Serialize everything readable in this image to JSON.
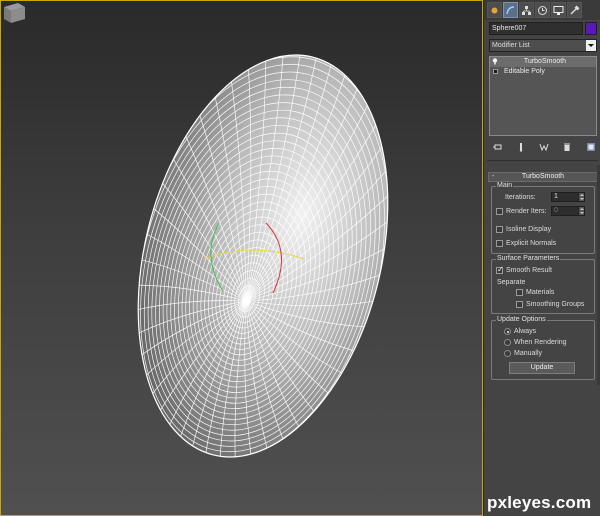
{
  "object": {
    "name": "Sphere007",
    "color": "#5a18b8"
  },
  "modifier_list": {
    "label": "Modifier List"
  },
  "stack": {
    "items": [
      {
        "label": "TurboSmooth",
        "selected": true
      },
      {
        "label": "Editable Poly",
        "selected": false
      }
    ]
  },
  "tabs": [
    "create-tab",
    "modify-tab",
    "hierarchy-tab",
    "motion-tab",
    "display-tab",
    "utilities-tab"
  ],
  "turbosmooth": {
    "title": "TurboSmooth",
    "main": {
      "title": "Main",
      "iterations_label": "Iterations:",
      "iterations_value": "1",
      "render_iters_label": "Render Iters:",
      "render_iters_value": "0",
      "isoline_display_label": "Isoline Display",
      "explicit_normals_label": "Explicit Normals"
    },
    "surface": {
      "title": "Surface Parameters",
      "smooth_result_label": "Smooth Result",
      "separate_label": "Separate",
      "materials_label": "Materials",
      "smoothing_groups_label": "Smoothing Groups"
    },
    "update": {
      "title": "Update Options",
      "always_label": "Always",
      "when_rendering_label": "When Rendering",
      "manually_label": "Manually",
      "update_button_label": "Update"
    }
  },
  "watermark": "pxleyes.com"
}
